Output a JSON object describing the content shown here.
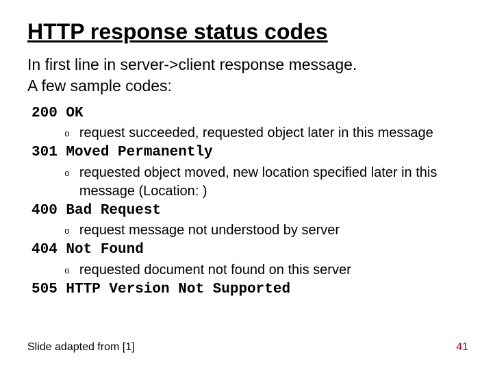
{
  "title": "HTTP response status codes",
  "intro_line1": "In first line in server->client response message.",
  "intro_line2": "A few sample codes:",
  "codes": {
    "c0": {
      "line": "200 OK",
      "desc": "request succeeded, requested object later in this message"
    },
    "c1": {
      "line": "301 Moved Permanently",
      "desc": "requested object moved, new location specified later in this message (Location: )"
    },
    "c2": {
      "line": "400 Bad Request",
      "desc": "request message not understood by server"
    },
    "c3": {
      "line": "404 Not Found",
      "desc": "requested document not found on this server"
    },
    "c4": {
      "line": "505 HTTP Version Not Supported"
    }
  },
  "bullet_char": "o",
  "footer_left": "Slide adapted from [1]",
  "footer_right": "41"
}
